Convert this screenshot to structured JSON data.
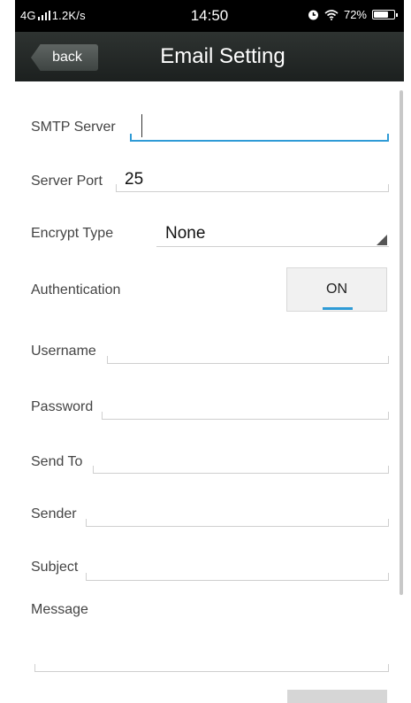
{
  "status_bar": {
    "network": "4G",
    "speed": "1.2K/s",
    "time": "14:50",
    "battery": "72%",
    "battery_level": 0.72
  },
  "header": {
    "back_label": "back",
    "title": "Email Setting"
  },
  "form": {
    "smtp_server": {
      "label": "SMTP Server",
      "value": ""
    },
    "server_port": {
      "label": "Server Port",
      "value": "25"
    },
    "encrypt_type": {
      "label": "Encrypt Type",
      "value": "None"
    },
    "authentication": {
      "label": "Authentication",
      "value": "ON"
    },
    "username": {
      "label": "Username",
      "value": ""
    },
    "password": {
      "label": "Password",
      "value": ""
    },
    "send_to": {
      "label": "Send To",
      "value": ""
    },
    "sender": {
      "label": "Sender",
      "value": ""
    },
    "subject": {
      "label": "Subject",
      "value": ""
    },
    "message": {
      "label": "Message",
      "value": ""
    }
  },
  "colors": {
    "accent": "#2f9bd6",
    "header_bg": "#1c201f",
    "status_bg": "#000000"
  }
}
